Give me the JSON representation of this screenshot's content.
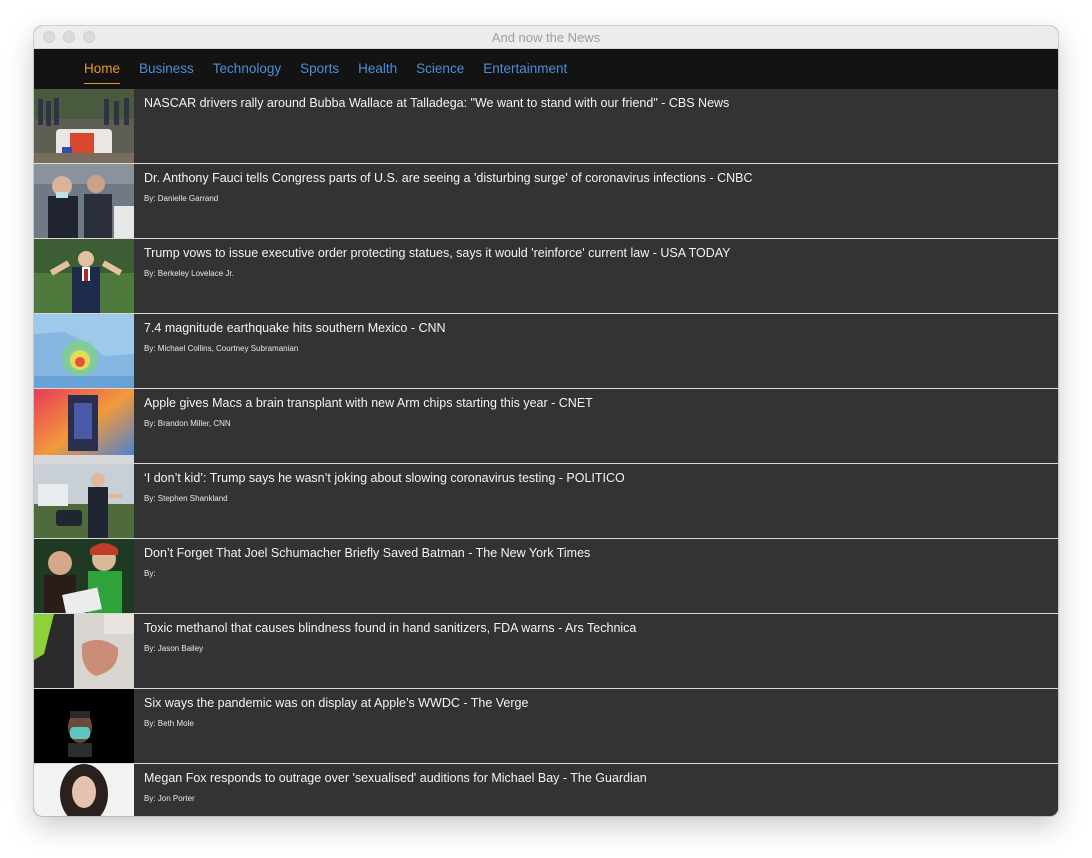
{
  "window": {
    "title": "And now the News"
  },
  "nav": {
    "tabs": [
      {
        "label": "Home",
        "active": true
      },
      {
        "label": "Business",
        "active": false
      },
      {
        "label": "Technology",
        "active": false
      },
      {
        "label": "Sports",
        "active": false
      },
      {
        "label": "Health",
        "active": false
      },
      {
        "label": "Science",
        "active": false
      },
      {
        "label": "Entertainment",
        "active": false
      }
    ],
    "colors": {
      "active": "#e69a21",
      "inactive": "#4a8fd8"
    }
  },
  "articles": [
    {
      "headline": "NASCAR drivers rally around Bubba Wallace at Talladega: \"We want to stand with our friend\" - CBS News",
      "byline": ""
    },
    {
      "headline": "Dr. Anthony Fauci tells Congress parts of U.S. are seeing a 'disturbing surge' of coronavirus infections - CNBC",
      "byline": "By: Danielle Garrand"
    },
    {
      "headline": "Trump vows to issue executive order protecting statues, says it would 'reinforce' current law - USA TODAY",
      "byline": "By: Berkeley Lovelace Jr."
    },
    {
      "headline": "7.4 magnitude earthquake hits southern Mexico - CNN",
      "byline": "By: Michael Collins, Courtney Subramanian"
    },
    {
      "headline": "Apple gives Macs a brain transplant with new Arm chips starting this year - CNET",
      "byline": "By: Brandon Miller, CNN"
    },
    {
      "headline": "‘I don’t kid’: Trump says he wasn’t joking about slowing coronavirus testing - POLITICO",
      "byline": "By: Stephen Shankland"
    },
    {
      "headline": "Don’t Forget That Joel Schumacher Briefly Saved Batman - The New York Times",
      "byline": "By:"
    },
    {
      "headline": "Toxic methanol that causes blindness found in hand sanitizers, FDA warns - Ars Technica",
      "byline": "By: Jason Bailey"
    },
    {
      "headline": "Six ways the pandemic was on display at Apple’s WWDC - The Verge",
      "byline": "By: Beth Mole"
    },
    {
      "headline": "Megan Fox responds to outrage over 'sexualised' auditions for Michael Bay - The Guardian",
      "byline": "By: Jon Porter"
    }
  ]
}
